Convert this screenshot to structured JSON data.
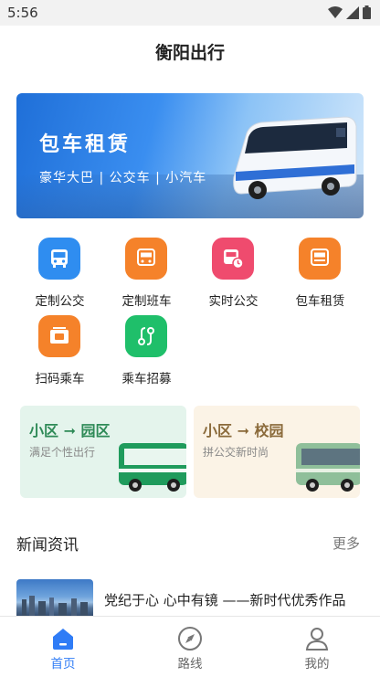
{
  "status_bar": {
    "time": "5:56"
  },
  "header": {
    "title": "衡阳出行"
  },
  "banner": {
    "title": "包车租赁",
    "subtitle": "豪华大巴 | 公交车 | 小汽车"
  },
  "services": [
    {
      "label": "定制公交",
      "icon": "bus-icon",
      "color": "#2f8df0"
    },
    {
      "label": "定制班车",
      "icon": "school-bus-icon",
      "color": "#f5822a"
    },
    {
      "label": "实时公交",
      "icon": "realtime-bus-icon",
      "color": "#ef4b6e"
    },
    {
      "label": "包车租赁",
      "icon": "charter-bus-icon",
      "color": "#f5822a"
    },
    {
      "label": "扫码乘车",
      "icon": "scan-card-icon",
      "color": "#f5822a"
    },
    {
      "label": "乘车招募",
      "icon": "route-recruit-icon",
      "color": "#1fbf6a"
    }
  ],
  "promos": [
    {
      "title": "小区 ➞ 园区",
      "subtitle": "满足个性出行",
      "title_color": "#2e8a57",
      "bg": "#e4f4ec"
    },
    {
      "title": "小区 ➞ 校园",
      "subtitle": "拼公交新时尚",
      "title_color": "#8a6a3a",
      "bg": "#fbf3e6"
    }
  ],
  "news": {
    "section_title": "新闻资讯",
    "more_label": "更多",
    "items": [
      {
        "title": "党纪于心 心中有镜 ——新时代优秀作品"
      }
    ]
  },
  "tabbar": {
    "items": [
      {
        "label": "首页",
        "icon": "home-icon",
        "active": true
      },
      {
        "label": "路线",
        "icon": "navigation-icon",
        "active": false
      },
      {
        "label": "我的",
        "icon": "profile-icon",
        "active": false
      }
    ],
    "active_color": "#2f7cf6"
  }
}
